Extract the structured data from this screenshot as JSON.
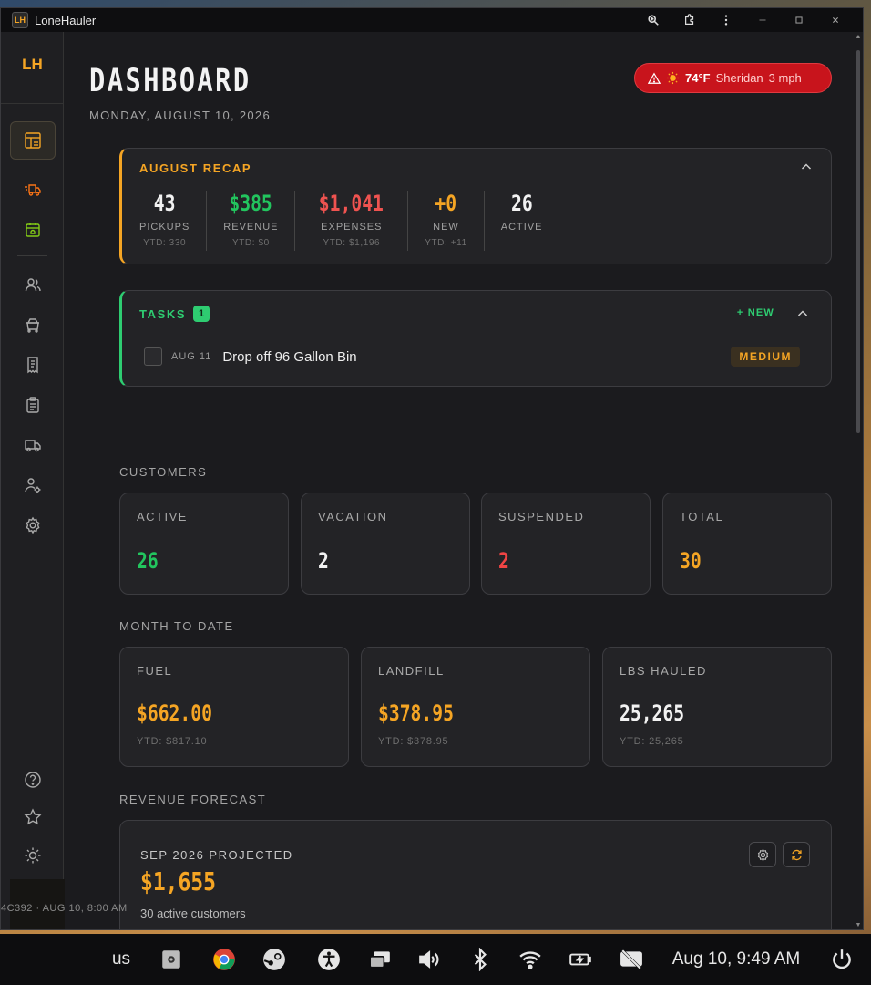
{
  "window": {
    "app_badge": "LH",
    "title": "LoneHauler"
  },
  "sidebar": {
    "logo": "LH"
  },
  "header": {
    "title": "DASHBOARD",
    "date": "MONDAY, AUGUST 10, 2026"
  },
  "weather": {
    "temp": "74°F",
    "location": "Sheridan",
    "wind": "3 mph"
  },
  "recap": {
    "title": "AUGUST RECAP",
    "stats": [
      {
        "value": "43",
        "label": "PICKUPS",
        "ytd": "YTD: 330",
        "color": "#f2f2f2"
      },
      {
        "value": "$385",
        "label": "REVENUE",
        "ytd": "YTD: $0",
        "color": "#22c55e"
      },
      {
        "value": "$1,041",
        "label": "EXPENSES",
        "ytd": "YTD: $1,196",
        "color": "#ef5350"
      },
      {
        "value": "+0",
        "label": "NEW",
        "ytd": "YTD: +11",
        "color": "#f5a524"
      },
      {
        "value": "26",
        "label": "ACTIVE",
        "ytd": "",
        "color": "#f2f2f2"
      }
    ]
  },
  "tasks": {
    "title": "TASKS",
    "count": "1",
    "new_label": "+ NEW",
    "items": [
      {
        "date": "AUG 11",
        "text": "Drop off 96 Gallon Bin",
        "priority": "MEDIUM"
      }
    ]
  },
  "customers": {
    "label": "CUSTOMERS",
    "cards": [
      {
        "label": "ACTIVE",
        "value": "26",
        "color": "#22c55e"
      },
      {
        "label": "VACATION",
        "value": "2",
        "color": "#f2f2f2"
      },
      {
        "label": "SUSPENDED",
        "value": "2",
        "color": "#ef4444"
      },
      {
        "label": "TOTAL",
        "value": "30",
        "color": "#f5a524"
      }
    ]
  },
  "month_to_date": {
    "label": "MONTH TO DATE",
    "cards": [
      {
        "label": "FUEL",
        "value": "$662.00",
        "ytd": "YTD: $817.10",
        "color": "#f5a524"
      },
      {
        "label": "LANDFILL",
        "value": "$378.95",
        "ytd": "YTD: $378.95",
        "color": "#f5a524"
      },
      {
        "label": "LBS HAULED",
        "value": "25,265",
        "ytd": "YTD: 25,265",
        "color": "#f2f2f2"
      }
    ]
  },
  "forecast": {
    "label": "REVENUE FORECAST",
    "projected_label": "SEP 2026 PROJECTED",
    "projected_value": "$1,655",
    "sub": "30 active customers"
  },
  "footer": {
    "text": "4C392 · AUG 10, 8:00 AM"
  },
  "taskbar": {
    "lang": "us",
    "clock": "Aug 10, 9:49 AM"
  },
  "colors": {
    "accent": "#f5a524",
    "success": "#22c55e",
    "danger": "#ef4444",
    "alert": "#c8141c"
  }
}
